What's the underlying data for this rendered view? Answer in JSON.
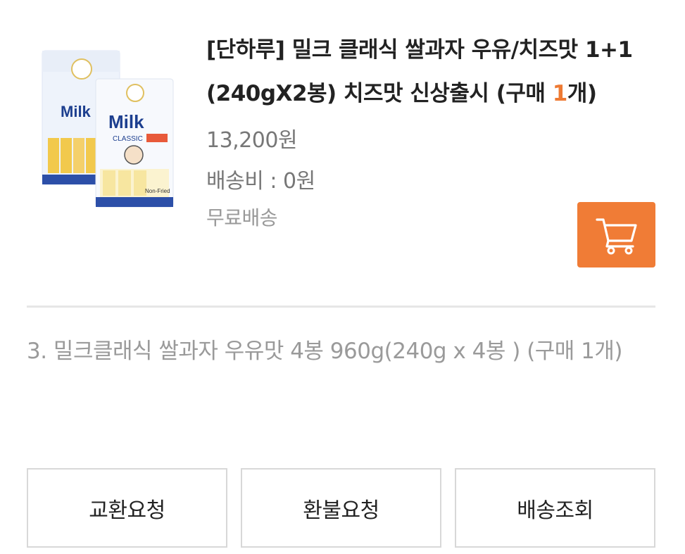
{
  "product": {
    "image_alt": "Milk Classic",
    "title_main": "[단하루] 밀크 클래식 쌀과자 우유/치즈맛 1+1 (240gX2봉) 치즈맛 신상출시 (구매 ",
    "qty": "1",
    "title_end": "개)",
    "price": "13,200원",
    "shipping_fee": "배송비 : 0원",
    "shipping_note": "무료배송",
    "cart_icon": "shopping-cart-icon"
  },
  "item3": {
    "text": "3. 밀크클래식 쌀과자 우유맛 4봉 960g(240g x 4봉 ) (구매 1개)"
  },
  "actions": {
    "exchange": "교환요청",
    "refund": "환불요청",
    "tracking": "배송조회"
  },
  "colors": {
    "accent": "#f07c36",
    "text": "#222222",
    "muted": "#777777",
    "light": "#999999",
    "border": "#d8d8d8"
  }
}
